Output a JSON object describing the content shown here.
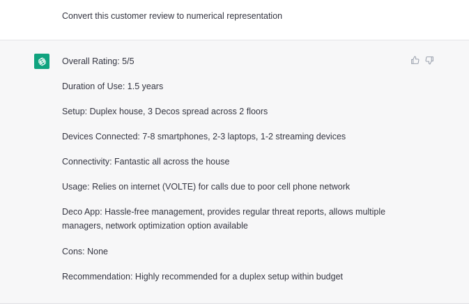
{
  "user_message": {
    "text": "Convert this customer review to numerical representation"
  },
  "assistant_message": {
    "lines": [
      "Overall Rating: 5/5",
      "Duration of Use: 1.5 years",
      "Setup: Duplex house, 3 Decos spread across 2 floors",
      "Devices Connected: 7-8 smartphones, 2-3 laptops, 1-2 streaming devices",
      "Connectivity: Fantastic all across the house",
      "Usage: Relies on internet (VOLTE) for calls due to poor cell phone network",
      "Deco App: Hassle-free management, provides regular threat reports, allows multiple managers, network optimization option available",
      "Cons: None",
      "Recommendation: Highly recommended for a duplex setup within budget"
    ]
  },
  "icons": {
    "avatar": "openai-logo-icon",
    "thumbs_up": "thumbs-up-icon",
    "thumbs_down": "thumbs-down-icon"
  },
  "colors": {
    "avatar_bg": "#10a37f",
    "assistant_bg": "#f7f7f8",
    "text": "#343541"
  }
}
